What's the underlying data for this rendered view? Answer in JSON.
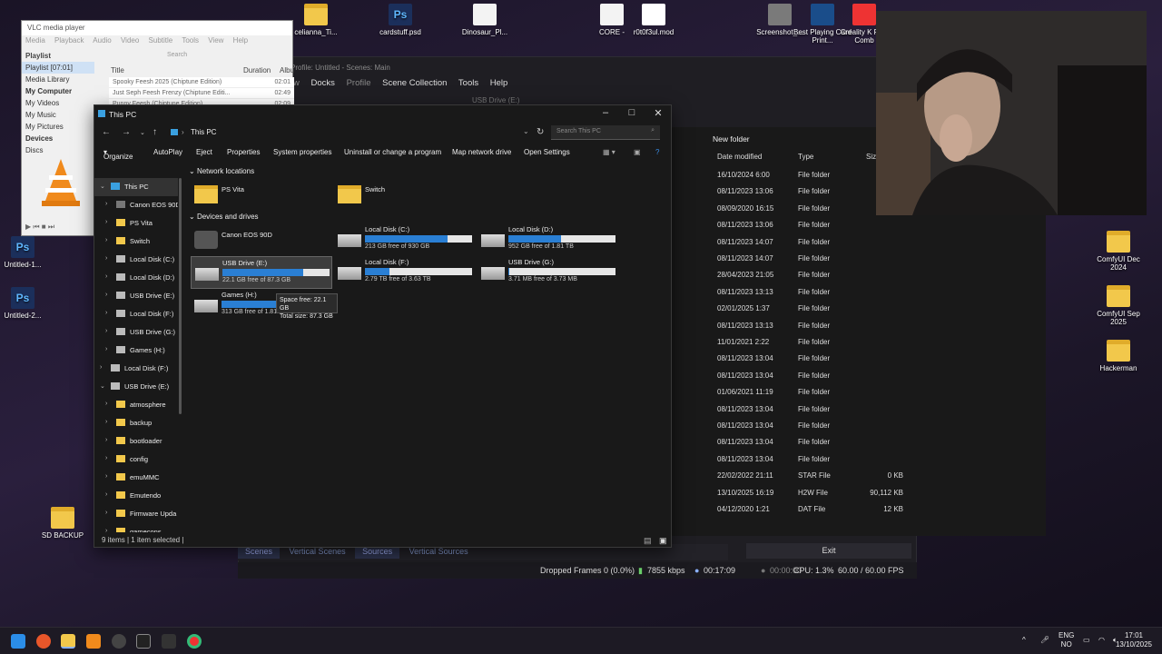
{
  "desktop": {
    "top_icons": [
      {
        "label": "celianna_Ti...",
        "icon": "folder"
      },
      {
        "label": "cardstuff.psd",
        "icon": "ps"
      },
      {
        "label": "Dinosaur_Pl...",
        "icon": "doc"
      },
      {
        "label": "CORE -",
        "icon": "doc"
      },
      {
        "label": "r0t0f3ul.mod",
        "icon": "vid"
      },
      {
        "label": "Screenshot_...",
        "icon": "app"
      },
      {
        "label": "Best Playing Card Print...",
        "icon": "app"
      },
      {
        "label": "Creality K Plus Comb",
        "icon": "app"
      }
    ],
    "left_icons": [
      {
        "label": "Untitled-1...",
        "icon": "ps"
      },
      {
        "label": "Untitled-2...",
        "icon": "ps"
      },
      {
        "label": "SD BACKUP",
        "icon": "folder"
      }
    ],
    "right_icons": [
      {
        "label": "ComfyUI Dec 2024",
        "icon": "folder"
      },
      {
        "label": "ComfyUI Sep 2025",
        "icon": "folder"
      },
      {
        "label": "Hackerman",
        "icon": "folder"
      }
    ]
  },
  "vlc": {
    "title": "VLC media player",
    "menu": [
      "Media",
      "Playback",
      "Audio",
      "Video",
      "Subtitle",
      "Tools",
      "View",
      "Help"
    ],
    "sidebar_header": "Playlist",
    "sidebar": [
      "Playlist [07:01]",
      "Media Library",
      "My Computer",
      "My Videos",
      "My Music",
      "My Pictures",
      "Devices",
      "Discs"
    ],
    "search_placeholder": "Search",
    "columns": {
      "title": "Title",
      "duration": "Duration",
      "album": "Albu"
    },
    "tracks": [
      {
        "title": "Spooky Feesh 2025 (Chiptune Edition)",
        "duration": "02:01"
      },
      {
        "title": "Just Seph Feesh Frenzy (Chiptune Editi...",
        "duration": "02:49"
      },
      {
        "title": "Punny Feesh (Chiptune Edition)",
        "duration": "02:09"
      }
    ]
  },
  "obs": {
    "title": "Profile: Untitled - Scenes: Main",
    "menu": [
      "Docks",
      "Profile",
      "Scene Collection",
      "Tools",
      "Help"
    ],
    "menu_prefix": "w",
    "tabs": [
      "Scenes",
      "Vertical Scenes",
      "Sources",
      "Vertical Sources"
    ],
    "exit_label": "Exit",
    "status": {
      "dropped": "Dropped Frames 0 (0.0%)",
      "bitrate": "7855 kbps",
      "rec_time": "00:17:09",
      "stream_time": "00:00:00",
      "cpu": "CPU: 1.3%",
      "fps": "60.00 / 60.00 FPS"
    }
  },
  "bg_explorer": {
    "tab_title": "USB Drive (E:)",
    "help_hint": "es",
    "new_folder": "New folder",
    "columns": {
      "date": "Date modified",
      "type": "Type",
      "size": "Size"
    },
    "rows": [
      {
        "date": "16/10/2024 6:00",
        "type": "File folder",
        "size": ""
      },
      {
        "date": "08/11/2023 13:06",
        "type": "File folder",
        "size": ""
      },
      {
        "date": "08/09/2020 16:15",
        "type": "File folder",
        "size": ""
      },
      {
        "date": "08/11/2023 13:06",
        "type": "File folder",
        "size": ""
      },
      {
        "date": "08/11/2023 14:07",
        "type": "File folder",
        "size": ""
      },
      {
        "date": "08/11/2023 14:07",
        "type": "File folder",
        "size": ""
      },
      {
        "date": "28/04/2023 21:05",
        "type": "File folder",
        "size": ""
      },
      {
        "date": "08/11/2023 13:13",
        "type": "File folder",
        "size": ""
      },
      {
        "date": "02/01/2025 1:37",
        "type": "File folder",
        "size": ""
      },
      {
        "date": "08/11/2023 13:13",
        "type": "File folder",
        "size": ""
      },
      {
        "date": "11/01/2021 2:22",
        "type": "File folder",
        "size": ""
      },
      {
        "date": "08/11/2023 13:04",
        "type": "File folder",
        "size": ""
      },
      {
        "date": "08/11/2023 13:04",
        "type": "File folder",
        "size": ""
      },
      {
        "date": "01/06/2021 11:19",
        "type": "File folder",
        "size": ""
      },
      {
        "date": "08/11/2023 13:04",
        "type": "File folder",
        "size": ""
      },
      {
        "date": "08/11/2023 13:04",
        "type": "File folder",
        "size": ""
      },
      {
        "date": "08/11/2023 13:04",
        "type": "File folder",
        "size": ""
      },
      {
        "date": "08/11/2023 13:04",
        "type": "File folder",
        "size": ""
      },
      {
        "date": "22/02/2022 21:11",
        "type": "STAR File",
        "size": "0 KB"
      },
      {
        "date": "13/10/2025 16:19",
        "type": "H2W File",
        "size": "90,112 KB"
      },
      {
        "date": "04/12/2020 1:21",
        "type": "DAT File",
        "size": "12 KB"
      }
    ]
  },
  "explorer": {
    "title": "This PC",
    "address": "This PC",
    "search_placeholder": "Search This PC",
    "commands": [
      "Organize",
      "AutoPlay",
      "Eject",
      "Properties",
      "System properties",
      "Uninstall or change a program",
      "Map network drive",
      "Open Settings"
    ],
    "tree": [
      {
        "label": "This PC",
        "level": 0,
        "expanded": true,
        "selected": true,
        "icon": "pc"
      },
      {
        "label": "Canon EOS 90D",
        "level": 1,
        "icon": "camera"
      },
      {
        "label": "PS Vita",
        "level": 1,
        "icon": "net"
      },
      {
        "label": "Switch",
        "level": 1,
        "icon": "net"
      },
      {
        "label": "Local Disk (C:)",
        "level": 1,
        "icon": "drive"
      },
      {
        "label": "Local Disk (D:)",
        "level": 1,
        "icon": "drive"
      },
      {
        "label": "USB Drive (E:)",
        "level": 1,
        "icon": "drive"
      },
      {
        "label": "Local Disk (F:)",
        "level": 1,
        "icon": "drive"
      },
      {
        "label": "USB Drive (G:)",
        "level": 1,
        "icon": "drive"
      },
      {
        "label": "Games (H:)",
        "level": 1,
        "icon": "drive"
      },
      {
        "label": "Local Disk (F:)",
        "level": 0,
        "icon": "drive"
      },
      {
        "label": "USB Drive (E:)",
        "level": 0,
        "expanded": true,
        "icon": "drive"
      },
      {
        "label": "atmosphere",
        "level": 1,
        "icon": "folder"
      },
      {
        "label": "backup",
        "level": 1,
        "icon": "folder"
      },
      {
        "label": "bootloader",
        "level": 1,
        "icon": "folder"
      },
      {
        "label": "config",
        "level": 1,
        "icon": "folder"
      },
      {
        "label": "emuMMC",
        "level": 1,
        "icon": "folder"
      },
      {
        "label": "Emutendo",
        "level": 1,
        "icon": "folder"
      },
      {
        "label": "Firmware Upda",
        "level": 1,
        "icon": "folder"
      },
      {
        "label": "gamecons",
        "level": 1,
        "icon": "folder"
      }
    ],
    "section_network": "Network locations",
    "section_devices": "Devices and drives",
    "network": [
      {
        "name": "PS Vita"
      },
      {
        "name": "Switch"
      }
    ],
    "camera": {
      "name": "Canon EOS 90D"
    },
    "drives": [
      {
        "name": "Local Disk (C:)",
        "info": "213 GB free of 930 GB",
        "used": 0.77
      },
      {
        "name": "Local Disk (D:)",
        "info": "952 GB free of 1.81 TB",
        "used": 0.49
      },
      {
        "name": "USB Drive (E:)",
        "info": "22.1 GB free of 87.3 GB",
        "used": 0.75,
        "selected": true
      },
      {
        "name": "Local Disk (F:)",
        "info": "2.79 TB free of 3.63 TB",
        "used": 0.23
      },
      {
        "name": "USB Drive (G:)",
        "info": "3.71 MB free of 3.73 MB",
        "used": 0.01
      },
      {
        "name": "Games (H:)",
        "info": "313 GB free of 1.81 TB",
        "used": 0.83
      }
    ],
    "tooltip": {
      "line1": "Space free: 22.1 GB",
      "line2": "Total size: 87.3 GB"
    },
    "status": "9 items  |  1 item selected  |"
  },
  "taskbar": {
    "lang": "ENG",
    "region": "NO",
    "time": "17:01",
    "date": "13/10/2025"
  }
}
